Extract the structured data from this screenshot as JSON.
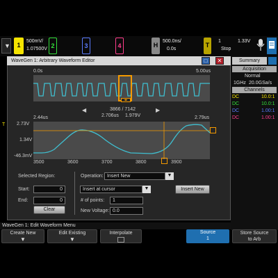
{
  "status": {
    "ch1_scale": "500mV/",
    "ch1_offset": "1.07500V",
    "ch2": "2",
    "ch3": "3",
    "ch4": "4",
    "h_label": "H",
    "time_scale": "500.0ns/",
    "time_delay": "0.0s",
    "trig_label": "T",
    "trig_ch": "1",
    "trig_level": "1.33V",
    "run_state": "Stop",
    "ch1_label": "1"
  },
  "editor": {
    "title": "WaveGen 1: Arbitrary Waveform Editor",
    "overview_start": "0.0s",
    "overview_end": "5.00us",
    "point_index": "3866 / 7142",
    "point_time": "2.706us",
    "point_volt": "1.979V",
    "zoom_start": "2.44us",
    "zoom_end": "2.79us",
    "y_top": "2.73V",
    "y_mid": "1.34V",
    "y_bot": "-46.3mV",
    "x_ticks": [
      "3500",
      "3600",
      "3700",
      "3800",
      "3900"
    ],
    "selected_region_label": "Selected Region:",
    "start_label": "Start:",
    "start_value": "0",
    "end_label": "End:",
    "end_value": "0",
    "clear_label": "Clear",
    "operation_label": "Operation:",
    "operation_value": "Insert New",
    "insert_mode_value": "Insert at cursor",
    "insert_new_button": "Insert New",
    "num_points_label": "# of points:",
    "num_points_value": "1",
    "new_voltage_label": "New Voltage:",
    "new_voltage_value": "0.0"
  },
  "summary": {
    "tab_label": "Summary",
    "acq_header": "Acquisition",
    "acq_mode": "Normal",
    "mem_depth": "1GHz",
    "sample_rate": "20.0GSa/s",
    "channels_header": "Channels",
    "channels": [
      {
        "coupling": "DC",
        "value": "10.0:1",
        "color": "#f5e400"
      },
      {
        "coupling": "DC",
        "value": "10.0:1",
        "color": "#33e03a"
      },
      {
        "coupling": "DC",
        "value": "1.00:1",
        "color": "#5a7cff"
      },
      {
        "coupling": "DC",
        "value": "1.00:1",
        "color": "#ff3d8c"
      }
    ]
  },
  "menu": {
    "status_text": "WaveGen 1: Edit Waveform Menu",
    "create_new": "Create New",
    "edit_existing": "Edit Existing",
    "interpolate": "Interpolate",
    "source_label": "Source",
    "source_value": "1",
    "store_source_line1": "Store Source",
    "store_source_line2": "to Arb"
  },
  "colors": {
    "ch1": "#f5e400",
    "ch2": "#33e03a",
    "ch3": "#5a7cff",
    "ch4": "#ff3d8c",
    "trace": "#3fbfd0",
    "cursor": "#f59a00",
    "source_key": "#1f6fb0"
  }
}
